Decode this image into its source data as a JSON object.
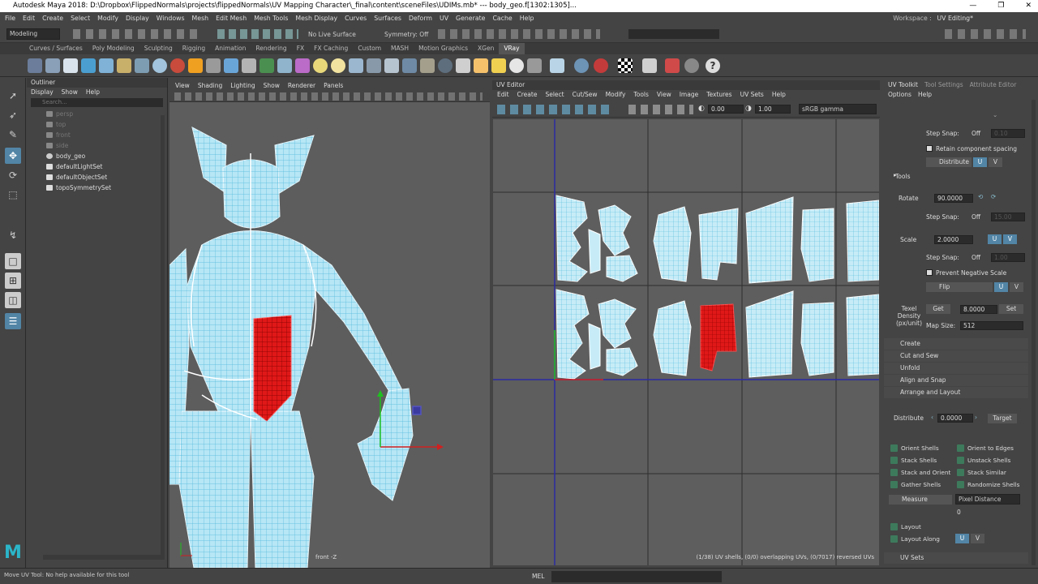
{
  "window": {
    "title": "Autodesk Maya 2018: D:\\Dropbox\\FlippedNormals\\projects\\flippedNormals\\UV Mapping Character\\_final\\content\\sceneFiles\\UDIMs.mb*  ---  body_geo.f[1302:1305]...",
    "minimize": "—",
    "maximize": "❐",
    "close": "✕"
  },
  "menubar": {
    "items": [
      "File",
      "Edit",
      "Create",
      "Select",
      "Modify",
      "Display",
      "Windows",
      "Mesh",
      "Edit Mesh",
      "Mesh Tools",
      "Mesh Display",
      "Curves",
      "Surfaces",
      "Deform",
      "UV",
      "Generate",
      "Cache",
      "Help"
    ],
    "workspace_label": "Workspace :",
    "workspace_value": "UV Editing*"
  },
  "statusline": {
    "mode": "Modeling",
    "live_surface": "No Live Surface",
    "symmetry": "Symmetry: Off"
  },
  "shelf": {
    "tabs": [
      "Curves / Surfaces",
      "Poly Modeling",
      "Sculpting",
      "Rigging",
      "Animation",
      "Rendering",
      "FX",
      "FX Caching",
      "Custom",
      "MASH",
      "Motion Graphics",
      "XGen",
      "VRay"
    ],
    "active_tab": "VRay"
  },
  "outliner": {
    "title": "Outliner",
    "menu": [
      "Display",
      "Show",
      "Help"
    ],
    "search_placeholder": "Search...",
    "items": [
      {
        "label": "persp",
        "dim": true
      },
      {
        "label": "top",
        "dim": true
      },
      {
        "label": "front",
        "dim": true
      },
      {
        "label": "side",
        "dim": true
      },
      {
        "label": "body_geo",
        "dim": false
      },
      {
        "label": "defaultLightSet",
        "dim": false
      },
      {
        "label": "defaultObjectSet",
        "dim": false
      },
      {
        "label": "topoSymmetrySet",
        "dim": false
      }
    ]
  },
  "viewport": {
    "menu": [
      "View",
      "Shading",
      "Lighting",
      "Show",
      "Renderer",
      "Panels"
    ],
    "camera_label": "front -Z"
  },
  "uv_editor": {
    "title": "UV Editor",
    "menu": [
      "Edit",
      "Create",
      "Select",
      "Cut/Sew",
      "Modify",
      "Tools",
      "View",
      "Image",
      "Textures",
      "UV Sets",
      "Help"
    ],
    "val1": "0.00",
    "val2": "1.00",
    "colorspace": "sRGB gamma",
    "status": "(1/38) UV shells, (0/0) overlapping UVs, (0/7017) reversed UVs"
  },
  "uv_toolkit": {
    "tabs": [
      "UV Toolkit",
      "Tool Settings",
      "Attribute Editor"
    ],
    "menu": [
      "Options",
      "Help"
    ],
    "step_snap_label": "Step Snap:",
    "step_snap_value": "Off",
    "step_snap_num1": "0.10",
    "step_snap_num2": "15.00",
    "step_snap_num3": "1.00",
    "retain_spacing": "Retain component spacing",
    "distribute_label": "Distribute",
    "u": "U",
    "v": "V",
    "tools_section": "Tools",
    "rotate_label": "Rotate",
    "rotate_value": "90.0000",
    "scale_label": "Scale",
    "scale_value": "2.0000",
    "prevent_negative": "Prevent Negative Scale",
    "flip_label": "Flip",
    "texel_label": "Texel Density (px/unit)",
    "get_label": "Get",
    "texel_value": "8.0000",
    "set_label": "Set",
    "map_size_label": "Map Size:",
    "map_size_value": "512",
    "sections": [
      "Create",
      "Cut and Sew",
      "Unfold",
      "Align and Snap",
      "Arrange and Layout"
    ],
    "distribute2_label": "Distribute",
    "distribute2_value": "0.0000",
    "target_label": "Target",
    "shell_buttons": [
      "Orient Shells",
      "Orient to Edges",
      "Stack Shells",
      "Unstack Shells",
      "Stack and Orient",
      "Stack Similar",
      "Gather Shells",
      "Randomize Shells"
    ],
    "measure_label": "Measure",
    "measure_value": "Pixel Distance",
    "measure_result": "0",
    "layout_label": "Layout",
    "layout_along_label": "Layout Along",
    "uv_sets_section": "UV Sets"
  },
  "bottom": {
    "help": "Move UV Tool: No help available for this tool",
    "mel": "MEL"
  },
  "colors": {
    "accent": "#5285a6",
    "wire": "#7fd7f2",
    "selected": "#e01818"
  }
}
